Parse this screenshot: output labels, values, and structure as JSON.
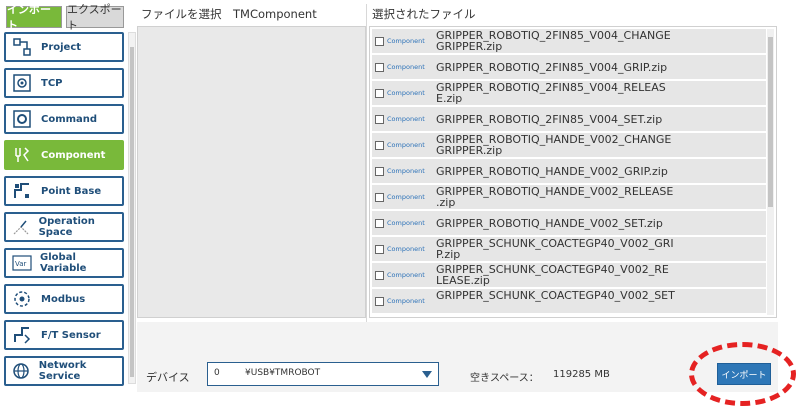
{
  "tabs": {
    "import": "インポート",
    "export": "エクスポート"
  },
  "menu": [
    {
      "label": "Project",
      "icon": "project-icon"
    },
    {
      "label": "TCP",
      "icon": "tcp-icon"
    },
    {
      "label": "Command",
      "icon": "command-icon"
    },
    {
      "label": "Component",
      "icon": "component-icon",
      "active": true
    },
    {
      "label": "Point Base",
      "icon": "point-base-icon"
    },
    {
      "label": "Operation Space",
      "icon": "operation-space-icon"
    },
    {
      "label": "Global Variable",
      "icon": "global-variable-icon"
    },
    {
      "label": "Modbus",
      "icon": "modbus-icon"
    },
    {
      "label": "F/T Sensor",
      "icon": "ft-sensor-icon"
    },
    {
      "label": "Network Service",
      "icon": "network-service-icon"
    }
  ],
  "left_panel": {
    "title": "ファイルを選択　TMComponent"
  },
  "right_panel": {
    "title": "選択されたファイル",
    "files": [
      {
        "tag": "Component",
        "name": "GRIPPER_ROBOTIQ_2FIN85_V004_CHANGE\nGRIPPER.zip"
      },
      {
        "tag": "Component",
        "name": "GRIPPER_ROBOTIQ_2FIN85_V004_GRIP.zip"
      },
      {
        "tag": "Component",
        "name": "GRIPPER_ROBOTIQ_2FIN85_V004_RELEAS\nE.zip"
      },
      {
        "tag": "Component",
        "name": "GRIPPER_ROBOTIQ_2FIN85_V004_SET.zip"
      },
      {
        "tag": "Component",
        "name": "GRIPPER_ROBOTIQ_HANDE_V002_CHANGE\nGRIPPER.zip"
      },
      {
        "tag": "Component",
        "name": "GRIPPER_ROBOTIQ_HANDE_V002_GRIP.zip"
      },
      {
        "tag": "Component",
        "name": "GRIPPER_ROBOTIQ_HANDE_V002_RELEASE\n.zip"
      },
      {
        "tag": "Component",
        "name": "GRIPPER_ROBOTIQ_HANDE_V002_SET.zip"
      },
      {
        "tag": "Component",
        "name": "GRIPPER_SCHUNK_COACTEGP40_V002_GRI\nP.zip"
      },
      {
        "tag": "Component",
        "name": "GRIPPER_SCHUNK_COACTEGP40_V002_RE\nLEASE.zip"
      },
      {
        "tag": "Component",
        "name": "GRIPPER_SCHUNK_COACTEGP40_V002_SET"
      }
    ]
  },
  "device": {
    "label": "デバイス",
    "number": "0",
    "path": "¥USB¥TMROBOT"
  },
  "free_space": {
    "label": "空きスペース：",
    "value": "119285 MB"
  },
  "import_button": "インポート",
  "colors": {
    "active_green": "#79b93a",
    "accent_blue": "#2e77b7",
    "highlight_red": "#e52222"
  }
}
